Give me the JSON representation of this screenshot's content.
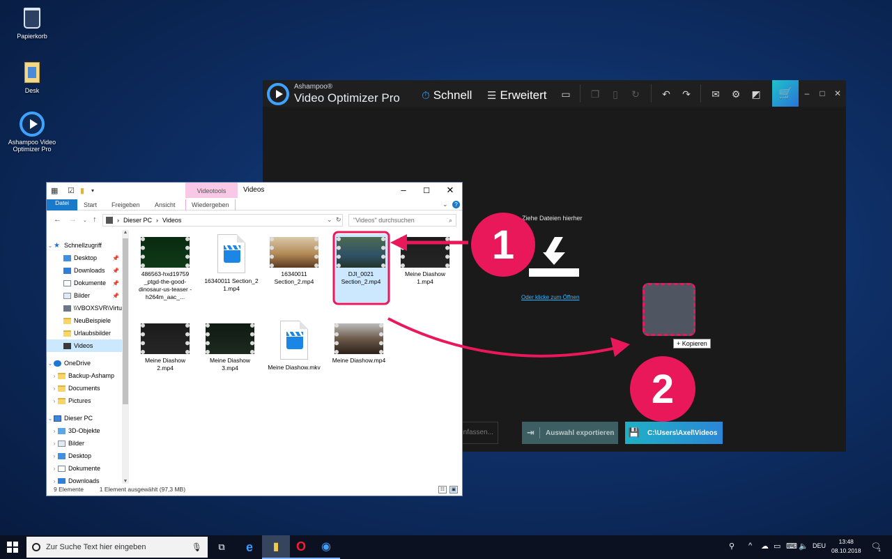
{
  "desktop": {
    "icons": [
      {
        "label": "Papierkorb"
      },
      {
        "label": "Desk"
      },
      {
        "label": "Ashampoo Video Optimizer Pro"
      }
    ]
  },
  "ashampoo": {
    "brand": "Ashampoo®",
    "title": "Video Optimizer Pro",
    "mode_quick": "Schnell",
    "mode_advanced": "Erweitert",
    "drop_hint": "Ziehe Dateien hierher",
    "open_link": "Oder klicke zum Öffnen",
    "copy_tooltip": "+ Kopieren",
    "btn_combine": "nfassen...",
    "btn_export": "Auswahl exportieren",
    "btn_path": "C:\\Users\\Axel\\Videos",
    "accent": "#3ea3ff"
  },
  "explorer": {
    "context_tab": "Videotools",
    "window_title": "Videos",
    "ribbon_tabs": {
      "file": "Datei",
      "start": "Start",
      "share": "Freigeben",
      "view": "Ansicht",
      "play": "Wiedergeben"
    },
    "address": {
      "root": "Dieser PC",
      "sep": "›",
      "folder": "Videos"
    },
    "search_placeholder": "\"Videos\" durchsuchen",
    "nav": {
      "quick_access": "Schnellzugriff",
      "desktop": "Desktop",
      "downloads": "Downloads",
      "documents": "Dokumente",
      "pictures": "Bilder",
      "network": "\\\\VBOXSVR\\Virtu",
      "neu": "NeuBeispiele",
      "urlaub": "Urlaubsbilder",
      "videos": "Videos",
      "onedrive": "OneDrive",
      "backup": "Backup-Ashamp",
      "od_documents": "Documents",
      "od_pictures": "Pictures",
      "this_pc": "Dieser PC",
      "objects3d": "3D-Objekte",
      "pc_pictures": "Bilder",
      "pc_desktop": "Desktop",
      "pc_documents": "Dokumente",
      "pc_downloads": "Downloads"
    },
    "files": [
      {
        "name": "486563-hxd19759 _ptgd-the-good- dinosaur-us-teaser -h264m_aac_..."
      },
      {
        "name": "16340011 Section_2 1.mp4"
      },
      {
        "name": "16340011 Section_2.mp4"
      },
      {
        "name": "DJI_0021 Section_2.mp4"
      },
      {
        "name": "Meine Diashow 1.mp4"
      },
      {
        "name": "Meine Diashow 2.mp4"
      },
      {
        "name": "Meine Diashow 3.mp4"
      },
      {
        "name": "Meine Diashow.mkv"
      },
      {
        "name": "Meine Diashow.mp4"
      }
    ],
    "status_count": "9 Elemente",
    "status_selected": "1 Element ausgewählt (97,3 MB)"
  },
  "annotations": {
    "step1": "1",
    "step2": "2",
    "color": "#e8185a"
  },
  "taskbar": {
    "search_placeholder": "Zur Suche Text hier eingeben",
    "lang": "DEU",
    "time": "13:48",
    "date": "08.10.2018",
    "notif_count": "1"
  }
}
